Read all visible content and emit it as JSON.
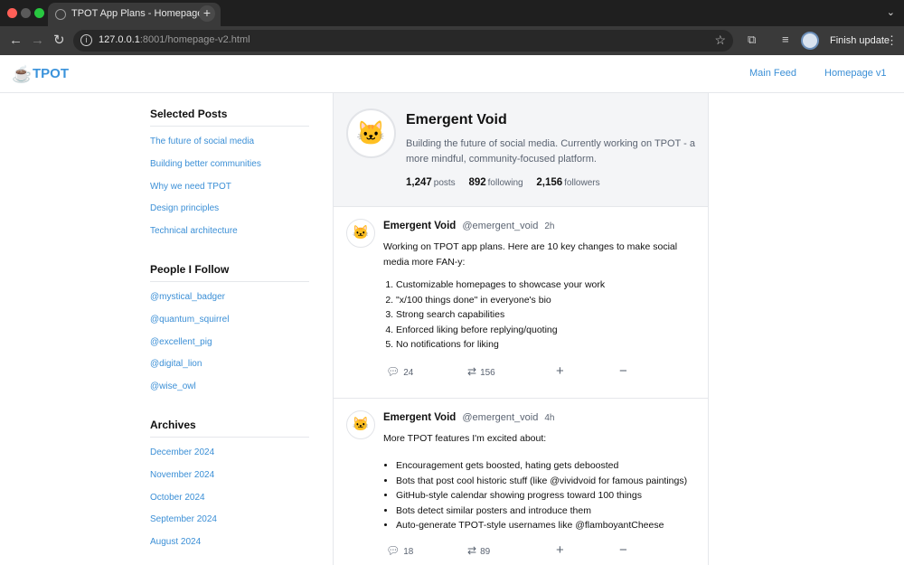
{
  "browser": {
    "tab_title": "TPOT App Plans - Homepage",
    "tab_close": "×",
    "new_tab": "+",
    "tab_search": "⌄",
    "url_host": "127.0.0.1",
    "url_rest": ":8001/homepage-v2.html",
    "finish_update": "Finish update"
  },
  "header": {
    "logo_icon": "☕",
    "logo_text": "TPOT",
    "nav": [
      "Main Feed",
      "Homepage v1"
    ]
  },
  "sidebar": {
    "selected_posts": {
      "title": "Selected Posts",
      "items": [
        "The future of social media",
        "Building better communities",
        "Why we need TPOT",
        "Design principles",
        "Technical architecture"
      ]
    },
    "people": {
      "title": "People I Follow",
      "items": [
        "@mystical_badger",
        "@quantum_squirrel",
        "@excellent_pig",
        "@digital_lion",
        "@wise_owl"
      ]
    },
    "archives": {
      "title": "Archives",
      "items": [
        "December 2024",
        "November 2024",
        "October 2024",
        "September 2024",
        "August 2024"
      ]
    }
  },
  "profile": {
    "avatar": "🐱",
    "name": "Emergent Void",
    "bio": "Building the future of social media. Currently working on TPOT - a more mindful, community-focused platform.",
    "stats": [
      {
        "value": "1,247",
        "label": "posts"
      },
      {
        "value": "892",
        "label": "following"
      },
      {
        "value": "2,156",
        "label": "followers"
      }
    ]
  },
  "posts": [
    {
      "avatar": "🐱",
      "author": "Emergent Void",
      "handle": "@emergent_void",
      "time": "2h",
      "text": "Working on TPOT app plans. Here are 10 key changes to make social media more FAN-y:",
      "list": [
        "Customizable homepages to showcase your work",
        "\"x/100 things done\" in everyone's bio",
        "Strong search capabilities",
        "Enforced liking before replying/quoting",
        "No notifications for liking"
      ],
      "replies": "24",
      "reposts": "156",
      "plus": "+",
      "minus": "−"
    },
    {
      "avatar": "🐱",
      "author": "Emergent Void",
      "handle": "@emergent_void",
      "time": "4h",
      "text": "More TPOT features I'm excited about:",
      "list": [
        "Encouragement gets boosted, hating gets deboosted",
        "Bots that post cool historic stuff (like @vividvoid for famous paintings)",
        "GitHub-style calendar showing progress toward 100 things",
        "Bots detect similar posters and introduce them",
        "Auto-generate TPOT-style usernames like @flamboyantCheese"
      ],
      "replies": "18",
      "reposts": "89",
      "plus": "+",
      "minus": "−"
    }
  ],
  "icons": {
    "reply": "speech-bubble-icon",
    "repost": "repost-arrows-icon"
  },
  "colors": {
    "accent": "#3b8fd6",
    "profile_bg": "#f4f5f7",
    "chrome_bg": "#1f1f1f"
  }
}
